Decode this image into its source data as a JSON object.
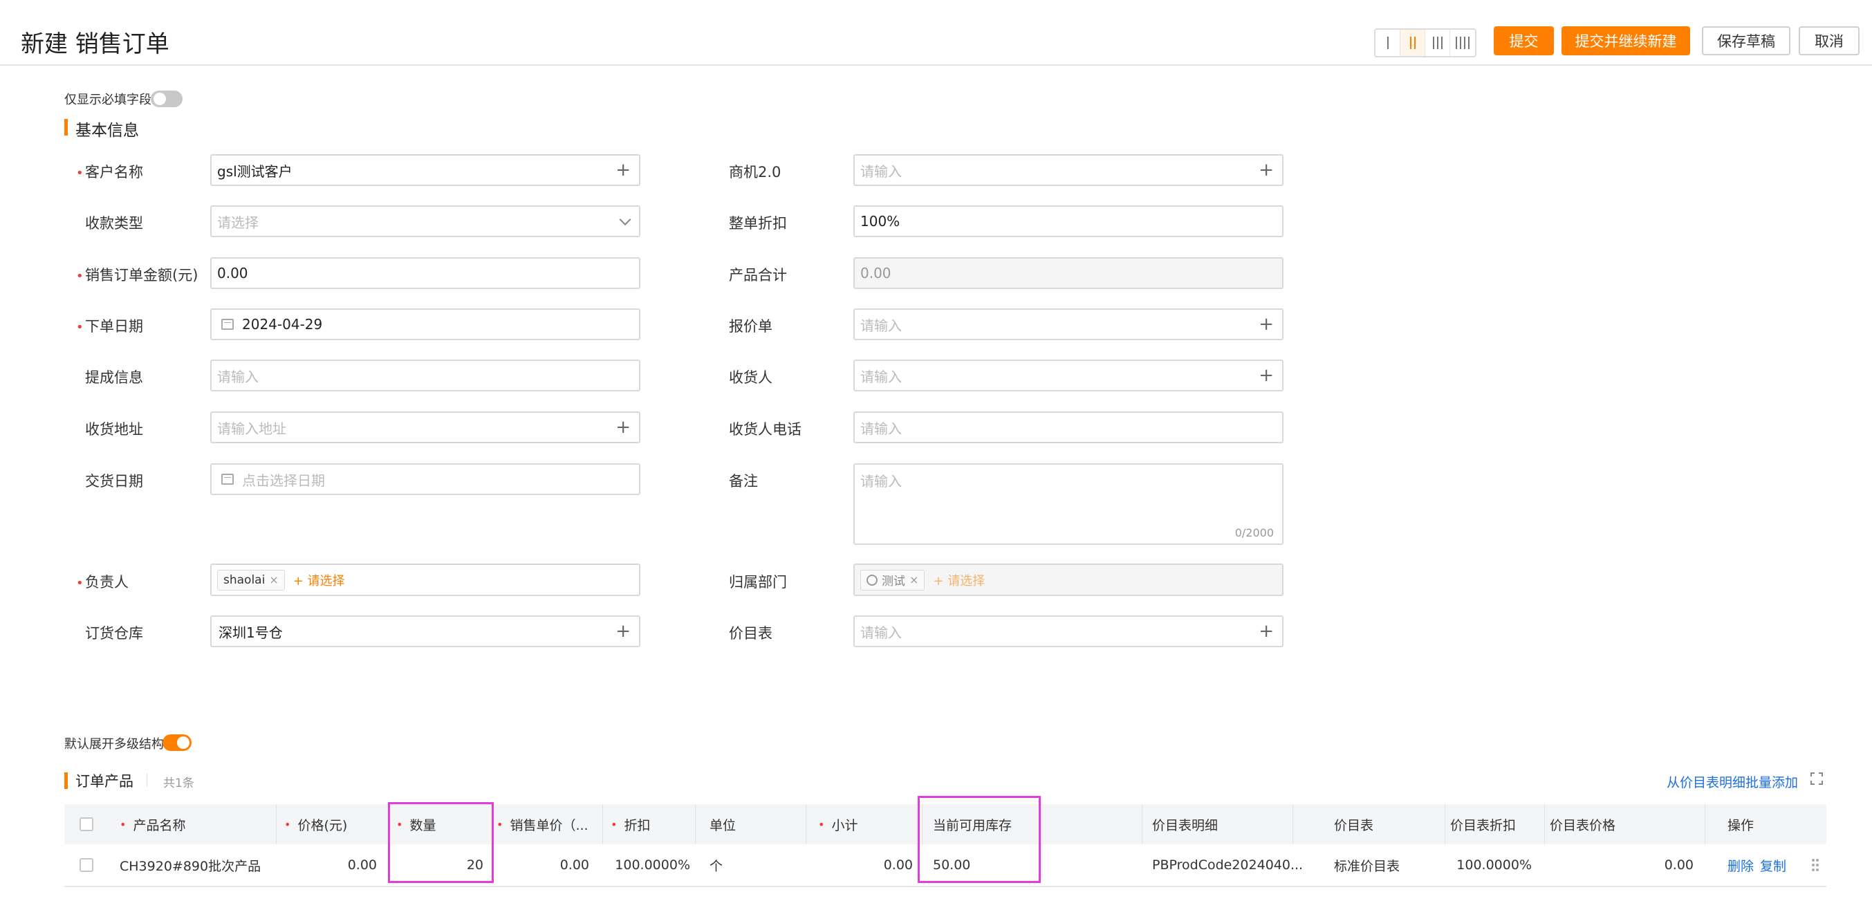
{
  "page": {
    "title": "新建 销售订单",
    "layout_options": [
      "1",
      "2",
      "3",
      "4"
    ],
    "layout_active": 2,
    "actions": {
      "submit": "提交",
      "submit_new": "提交并继续新建",
      "save_draft": "保存草稿",
      "cancel": "取消"
    }
  },
  "colors": {
    "accent": "#ff8000",
    "required": "#f03c3c",
    "link": "#1d6fe0",
    "highlight": "#e43be0"
  },
  "only_required": {
    "label": "仅显示必填字段",
    "on": false
  },
  "basic": {
    "title": "基本信息",
    "fields": {
      "customer": {
        "label": "客户名称",
        "value": "gsl测试客户",
        "required": true
      },
      "payment_type": {
        "label": "收款类型",
        "placeholder": "请选择"
      },
      "order_amount": {
        "label": "销售订单金额(元)",
        "value": "0.00",
        "required": true
      },
      "order_date": {
        "label": "下单日期",
        "value": "2024-04-29",
        "required": true
      },
      "commission": {
        "label": "提成信息",
        "placeholder": "请输入"
      },
      "ship_address": {
        "label": "收货地址",
        "placeholder": "请输入地址"
      },
      "delivery_date": {
        "label": "交货日期",
        "placeholder": "点击选择日期"
      },
      "owner": {
        "label": "负责人",
        "tag": "shaolai",
        "add": "+ 请选择",
        "required": true
      },
      "warehouse": {
        "label": "订货仓库",
        "value": "深圳1号仓"
      },
      "opportunity": {
        "label": "商机2.0",
        "placeholder": "请输入"
      },
      "discount": {
        "label": "整单折扣",
        "value": "100%"
      },
      "product_total": {
        "label": "产品合计",
        "value": "0.00"
      },
      "quote": {
        "label": "报价单",
        "placeholder": "请输入"
      },
      "receiver": {
        "label": "收货人",
        "placeholder": "请输入"
      },
      "receiver_phone": {
        "label": "收货人电话",
        "placeholder": "请输入"
      },
      "remark": {
        "label": "备注",
        "placeholder": "请输入",
        "counter": "0/2000"
      },
      "department": {
        "label": "归属部门",
        "tag": "测试",
        "add": "+ 请选择"
      },
      "price_book": {
        "label": "价目表",
        "placeholder": "请输入"
      }
    }
  },
  "multi_level": {
    "label": "默认展开多级结构",
    "on": true
  },
  "products": {
    "title": "订单产品",
    "count": "共1条",
    "batch_add": "从价目表明细批量添加",
    "columns": {
      "name": "产品名称",
      "price": "价格(元)",
      "qty": "数量",
      "unit_price": "销售单价（...",
      "discount": "折扣",
      "unit": "单位",
      "subtotal": "小计",
      "stock": "当前可用库存",
      "pb_detail": "价目表明细",
      "pb": "价目表",
      "pb_discount": "价目表折扣",
      "pb_price": "价目表价格",
      "ops": "操作"
    },
    "rows": [
      {
        "name": "CH3920#890批次产品",
        "price": "0.00",
        "qty": "20",
        "unit_price": "0.00",
        "discount": "100.0000%",
        "unit": "个",
        "subtotal": "0.00",
        "stock": "50.00",
        "pb_detail": "PBProdCode2024040...",
        "pb": "标准价目表",
        "pb_discount": "100.0000%",
        "pb_price": "0.00",
        "delete": "删除",
        "copy": "复制"
      }
    ]
  }
}
